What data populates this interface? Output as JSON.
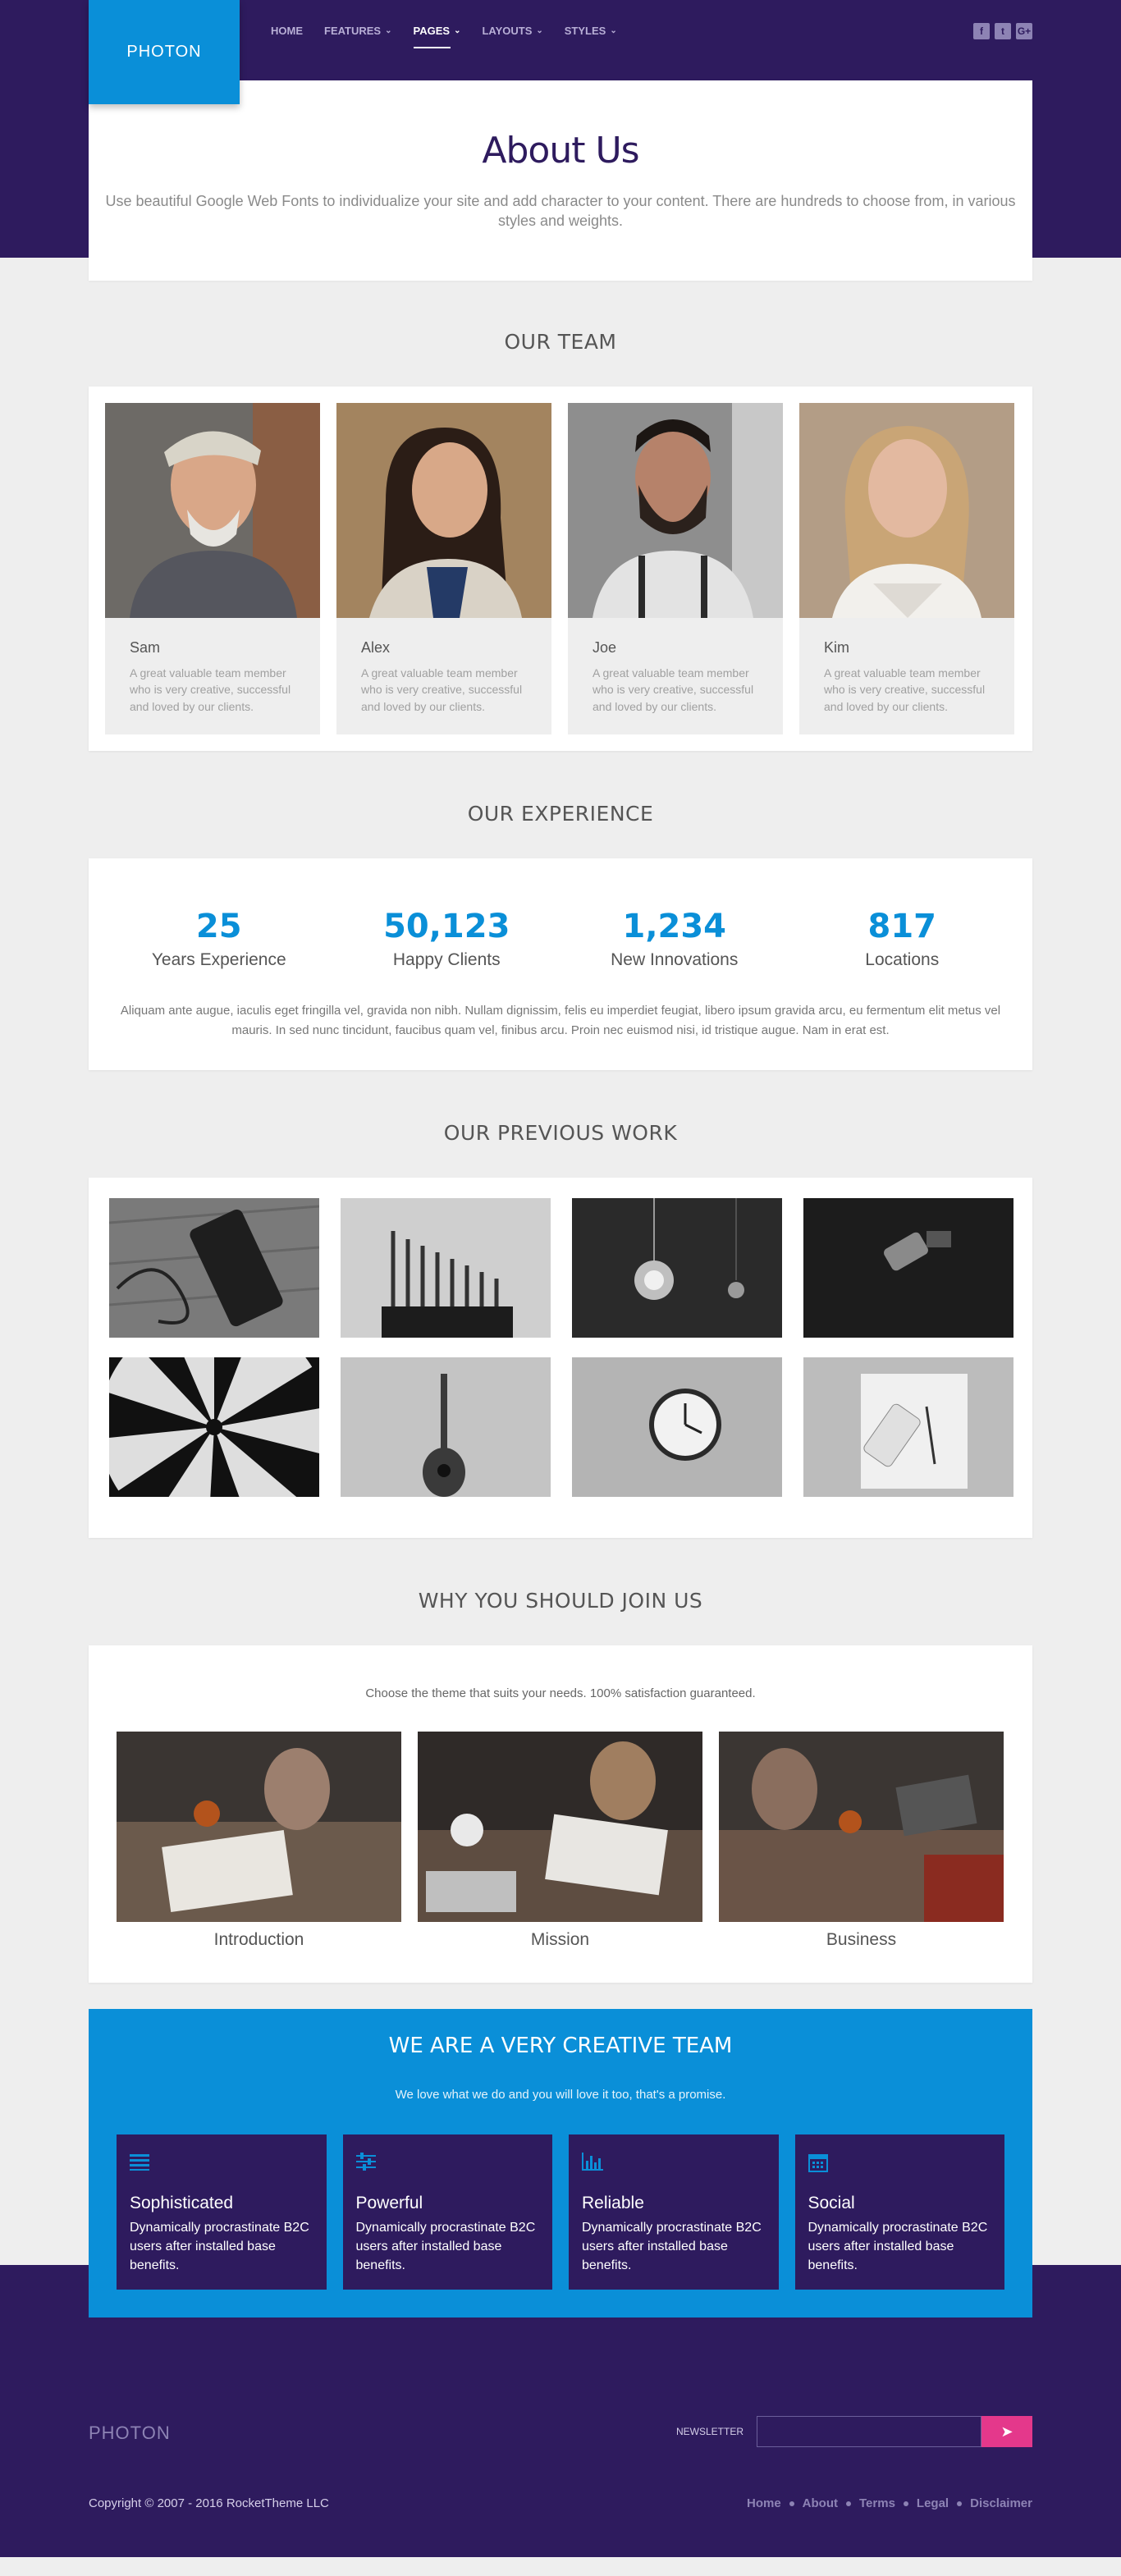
{
  "header": {
    "logo": "PHOTON",
    "nav": [
      {
        "label": "Home",
        "dropdown": false,
        "active": false
      },
      {
        "label": "Features",
        "dropdown": true,
        "active": false
      },
      {
        "label": "Pages",
        "dropdown": true,
        "active": true
      },
      {
        "label": "Layouts",
        "dropdown": true,
        "active": false
      },
      {
        "label": "Styles",
        "dropdown": true,
        "active": false
      }
    ],
    "social": [
      "f",
      "t",
      "G+"
    ]
  },
  "hero": {
    "title": "About Us",
    "text": "Use beautiful Google Web Fonts to individualize your site and add character to your content. There are hundreds to choose from, in various styles and weights."
  },
  "team": {
    "title": "OUR TEAM",
    "members": [
      {
        "name": "Sam",
        "bio": "A great valuable team member who is very creative, successful and loved by our clients."
      },
      {
        "name": "Alex",
        "bio": "A great valuable team member who is very creative, successful and loved by our clients."
      },
      {
        "name": "Joe",
        "bio": "A great valuable team member who is very creative, successful and loved by our clients."
      },
      {
        "name": "Kim",
        "bio": "A great valuable team member who is very creative, successful and loved by our clients."
      }
    ]
  },
  "experience": {
    "title": "OUR EXPERIENCE",
    "stats": [
      {
        "value": "25",
        "label": "Years Experience"
      },
      {
        "value": "50,123",
        "label": "Happy Clients"
      },
      {
        "value": "1,234",
        "label": "New Innovations"
      },
      {
        "value": "817",
        "label": "Locations"
      }
    ],
    "text": "Aliquam ante augue, iaculis eget fringilla vel, gravida non nibh. Nullam dignissim, felis eu imperdiet feugiat, libero ipsum gravida arcu, eu fermentum elit metus vel mauris. In sed nunc tincidunt, faucibus quam vel, finibus arcu. Proin nec euismod nisi, id tristique augue. Nam in erat est."
  },
  "work": {
    "title": "OUR PREVIOUS WORK"
  },
  "join": {
    "title": "WHY YOU SHOULD JOIN US",
    "tagline": "Choose the theme that suits your needs. 100% satisfaction guaranteed.",
    "items": [
      {
        "label": "Introduction"
      },
      {
        "label": "Mission"
      },
      {
        "label": "Business"
      }
    ]
  },
  "creative": {
    "title": "WE ARE A VERY CREATIVE TEAM",
    "subtitle": "We love what we do and you will love it too, that's a promise.",
    "features": [
      {
        "icon": "list-icon",
        "title": "Sophisticated",
        "text": "Dynamically procrastinate B2C users after installed base benefits."
      },
      {
        "icon": "sliders-icon",
        "title": "Powerful",
        "text": "Dynamically procrastinate B2C users after installed base benefits."
      },
      {
        "icon": "bar-chart-icon",
        "title": "Reliable",
        "text": "Dynamically procrastinate B2C users after installed base benefits."
      },
      {
        "icon": "calendar-icon",
        "title": "Social",
        "text": "Dynamically procrastinate B2C users after installed base benefits."
      }
    ]
  },
  "footer": {
    "logo": "PHOTON",
    "newsletter_label": "Newsletter",
    "newsletter_placeholder": "",
    "copyright": "Copyright © 2007 - 2016 RocketTheme LLC",
    "links": [
      "Home",
      "About",
      "Terms",
      "Legal",
      "Disclaimer"
    ]
  },
  "colors": {
    "brand_purple": "#2e1b5e",
    "accent_blue": "#0a8fd8",
    "accent_pink": "#e4388b"
  }
}
